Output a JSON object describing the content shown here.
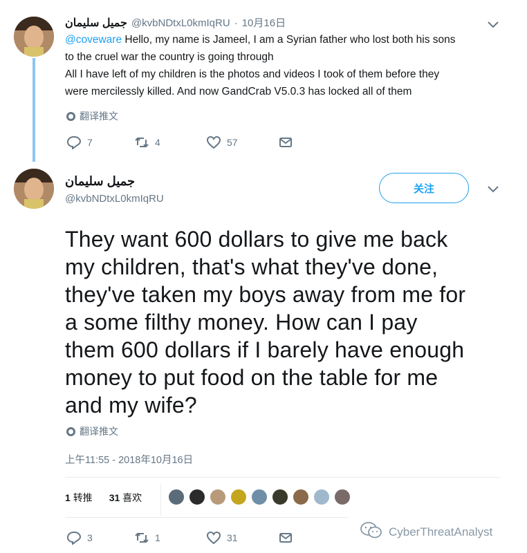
{
  "reply_tweet": {
    "display_name": "جميل سليمان",
    "handle": "@kvbNDtxL0kmIqRU",
    "separator": "·",
    "date": "10月16日",
    "mention": "@coveware",
    "text_line1": " Hello, my name is Jameel, I am a Syrian father who lost both his sons",
    "text_line2": "to the cruel war the country is going through",
    "text_line3": "All I have left of my children is the photos and videos I took of them before they",
    "text_line4": "were mercilessly killed. And now GandCrab V5.0.3 has locked all of them",
    "translate": "翻译推文",
    "replies": "7",
    "retweets": "4",
    "likes": "57"
  },
  "main_tweet": {
    "display_name": "جميل سليمان",
    "handle": "@kvbNDtxL0kmIqRU",
    "follow_label": "关注",
    "text_lines": [
      "They want 600 dollars to give me back",
      "my children, that's what they've done,",
      "they've taken my boys away from me for",
      "a some filthy money. How can I pay",
      "them 600 dollars if I barely have enough",
      "money to put food on the table for me",
      "and my wife?"
    ],
    "translate": "翻译推文",
    "timestamp": "上午11:55 - 2018年10月16日",
    "retweet_count": "1",
    "retweet_label": "转推",
    "like_count": "31",
    "like_label": "喜欢",
    "replies": "3",
    "retweets": "1",
    "likes": "31"
  },
  "watermark": "CyberThreatAnalyst",
  "colors": {
    "accent": "#1da1f2",
    "muted": "#657786",
    "text": "#14171a",
    "thread_line": "#8fc4f0"
  },
  "icons": [
    "chevron-down-icon",
    "globe-icon",
    "reply-icon",
    "retweet-icon",
    "heart-icon",
    "message-icon",
    "wechat-icon"
  ]
}
